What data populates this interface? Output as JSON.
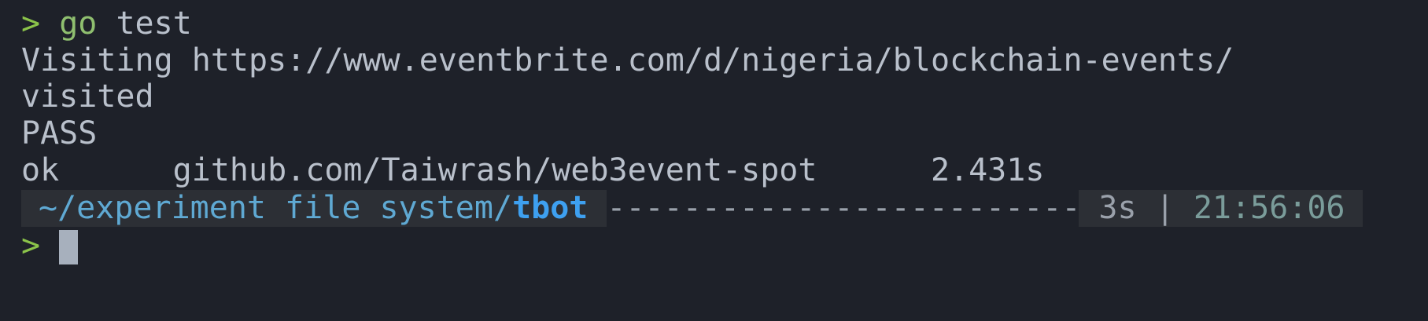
{
  "terminal": {
    "prompt_symbol": ">",
    "command": {
      "name": "go",
      "arg": "test"
    },
    "output_lines": [
      "Visiting https://www.eventbrite.com/d/nigeria/blockchain-events/",
      "visited",
      "PASS",
      "ok      github.com/Taiwrash/web3event-spot      2.431s"
    ],
    "statusbar": {
      "path_prefix": "~/experiment file system/",
      "path_current": "tbot",
      "dashes": "------------------------------------------------",
      "duration": "3s",
      "separator": "|",
      "time": "21:56:06"
    },
    "colors": {
      "background": "#1e2129",
      "prompt": "#8bc34a",
      "path": "#5fa9d3",
      "path_bold": "#3ea0f0",
      "text": "#b9c0cb"
    }
  }
}
